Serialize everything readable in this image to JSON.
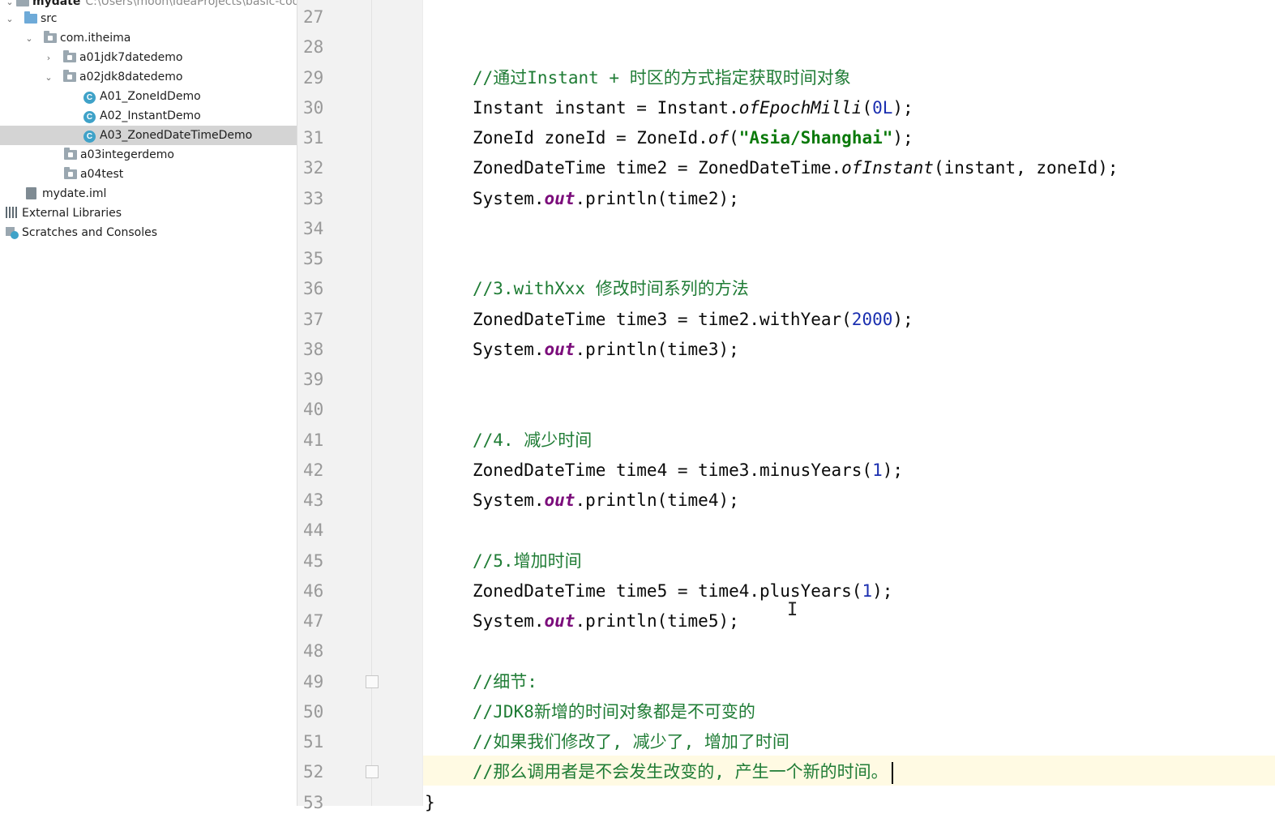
{
  "project_tree": {
    "root": {
      "label": "mydate",
      "path": "C:\\Users\\moon\\IdeaProjects\\basic-code"
    },
    "items": [
      {
        "label": "src"
      },
      {
        "label": "com.itheima"
      },
      {
        "label": "a01jdk7datedemo"
      },
      {
        "label": "a02jdk8datedemo"
      },
      {
        "label": "A01_ZoneIdDemo",
        "icon": "C"
      },
      {
        "label": "A02_InstantDemo",
        "icon": "C"
      },
      {
        "label": "A03_ZonedDateTimeDemo",
        "icon": "C"
      },
      {
        "label": "a03integerdemo"
      },
      {
        "label": "a04test"
      },
      {
        "label": "mydate.iml"
      },
      {
        "label": "External Libraries"
      },
      {
        "label": "Scratches and Consoles"
      }
    ]
  },
  "editor": {
    "line_numbers": [
      "27",
      "28",
      "29",
      "30",
      "31",
      "32",
      "33",
      "34",
      "35",
      "36",
      "37",
      "38",
      "39",
      "40",
      "41",
      "42",
      "43",
      "44",
      "45",
      "46",
      "47",
      "48",
      "49",
      "50",
      "51",
      "52",
      "53"
    ],
    "lines": [
      {
        "n": "29",
        "tokens": [
          {
            "t": "//通过Instant + 时区的方式指定获取时间对象",
            "c": "cmt"
          }
        ]
      },
      {
        "n": "30",
        "tokens": [
          {
            "t": "Instant instant = Instant."
          },
          {
            "t": "ofEpochMilli",
            "c": "ital"
          },
          {
            "t": "("
          },
          {
            "t": "0L",
            "c": "num"
          },
          {
            "t": ");"
          }
        ]
      },
      {
        "n": "31",
        "tokens": [
          {
            "t": "ZoneId zoneId = ZoneId."
          },
          {
            "t": "of",
            "c": "ital"
          },
          {
            "t": "("
          },
          {
            "t": "\"Asia/Shanghai\"",
            "c": "str"
          },
          {
            "t": ");"
          }
        ]
      },
      {
        "n": "32",
        "tokens": [
          {
            "t": "ZonedDateTime time2 = ZonedDateTime."
          },
          {
            "t": "ofInstant",
            "c": "ital"
          },
          {
            "t": "(instant, zoneId);"
          }
        ]
      },
      {
        "n": "33",
        "tokens": [
          {
            "t": "System."
          },
          {
            "t": "out",
            "c": "fld"
          },
          {
            "t": ".println(time2);"
          }
        ]
      },
      {
        "n": "36",
        "tokens": [
          {
            "t": "//3.withXxx 修改时间系列的方法",
            "c": "cmt"
          }
        ]
      },
      {
        "n": "37",
        "tokens": [
          {
            "t": "ZonedDateTime time3 = time2.withYear("
          },
          {
            "t": "2000",
            "c": "num"
          },
          {
            "t": ");"
          }
        ]
      },
      {
        "n": "38",
        "tokens": [
          {
            "t": "System."
          },
          {
            "t": "out",
            "c": "fld"
          },
          {
            "t": ".println(time3);"
          }
        ]
      },
      {
        "n": "41",
        "tokens": [
          {
            "t": "//4. 减少时间",
            "c": "cmt"
          }
        ]
      },
      {
        "n": "42",
        "tokens": [
          {
            "t": "ZonedDateTime time4 = time3.minusYears("
          },
          {
            "t": "1",
            "c": "num"
          },
          {
            "t": ");"
          }
        ]
      },
      {
        "n": "43",
        "tokens": [
          {
            "t": "System."
          },
          {
            "t": "out",
            "c": "fld"
          },
          {
            "t": ".println(time4);"
          }
        ]
      },
      {
        "n": "45",
        "tokens": [
          {
            "t": "//5.增加时间",
            "c": "cmt"
          }
        ]
      },
      {
        "n": "46",
        "tokens": [
          {
            "t": "ZonedDateTime time5 = time4.plusYears("
          },
          {
            "t": "1",
            "c": "num"
          },
          {
            "t": ");"
          }
        ]
      },
      {
        "n": "47",
        "tokens": [
          {
            "t": "System."
          },
          {
            "t": "out",
            "c": "fld"
          },
          {
            "t": ".println(time5);"
          }
        ]
      },
      {
        "n": "49",
        "tokens": [
          {
            "t": "//细节:",
            "c": "cmt"
          }
        ]
      },
      {
        "n": "50",
        "tokens": [
          {
            "t": "//JDK8新增的时间对象都是不可变的",
            "c": "cmt"
          }
        ]
      },
      {
        "n": "51",
        "tokens": [
          {
            "t": "//如果我们修改了, 减少了, 增加了时间",
            "c": "cmt"
          }
        ]
      },
      {
        "n": "52",
        "tokens": [
          {
            "t": "//那么调用者是不会发生改变的, 产生一个新的时间。",
            "c": "cmt"
          }
        ]
      },
      {
        "n": "53",
        "tokens": [
          {
            "t": "}"
          }
        ]
      }
    ],
    "current_line": "52"
  },
  "colors": {
    "comment": "#1f7c35",
    "string": "#0b7a0b",
    "number": "#1b2fb0",
    "field": "#7b0d7b",
    "gutter": "#f2f2f2",
    "current_line": "#fffae3"
  }
}
